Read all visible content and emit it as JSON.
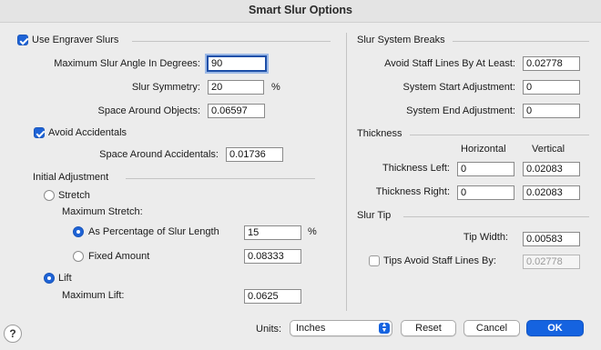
{
  "window": {
    "title": "Smart Slur Options"
  },
  "engraver": {
    "use_engraver_slurs": {
      "label": "Use Engraver Slurs",
      "checked": true
    },
    "max_angle": {
      "label": "Maximum Slur Angle In Degrees:",
      "value": "90"
    },
    "symmetry": {
      "label": "Slur Symmetry:",
      "value": "20",
      "unit": "%"
    },
    "space_around_objects": {
      "label": "Space Around Objects:",
      "value": "0.06597"
    },
    "avoid_accidentals": {
      "label": "Avoid Accidentals",
      "checked": true
    },
    "space_around_accidentals": {
      "label": "Space Around Accidentals:",
      "value": "0.01736"
    }
  },
  "initial_adjustment": {
    "heading": "Initial Adjustment",
    "stretch": {
      "label": "Stretch",
      "selected": false
    },
    "maximum_stretch_label": "Maximum Stretch:",
    "percentage": {
      "label": "As Percentage of Slur Length",
      "value": "15",
      "unit": "%",
      "selected": true
    },
    "fixed_amount": {
      "label": "Fixed Amount",
      "value": "0.08333",
      "selected": false
    },
    "lift": {
      "label": "Lift",
      "selected": true
    },
    "maximum_lift": {
      "label": "Maximum Lift:",
      "value": "0.0625"
    }
  },
  "system_breaks": {
    "heading": "Slur System Breaks",
    "avoid_staff_lines": {
      "label": "Avoid Staff Lines By At Least:",
      "value": "0.02778"
    },
    "system_start": {
      "label": "System Start Adjustment:",
      "value": "0"
    },
    "system_end": {
      "label": "System End Adjustment:",
      "value": "0"
    }
  },
  "thickness": {
    "heading": "Thickness",
    "col_horizontal": "Horizontal",
    "col_vertical": "Vertical",
    "left": {
      "label": "Thickness Left:",
      "horizontal": "0",
      "vertical": "0.02083"
    },
    "right": {
      "label": "Thickness Right:",
      "horizontal": "0",
      "vertical": "0.02083"
    }
  },
  "slur_tip": {
    "heading": "Slur Tip",
    "tip_width": {
      "label": "Tip Width:",
      "value": "0.00583"
    },
    "tips_avoid": {
      "label": "Tips Avoid Staff Lines By:",
      "value": "0.02778",
      "checked": false
    }
  },
  "footer": {
    "help": "?",
    "units_label": "Units:",
    "units_value": "Inches",
    "reset": "Reset",
    "cancel": "Cancel",
    "ok": "OK"
  }
}
